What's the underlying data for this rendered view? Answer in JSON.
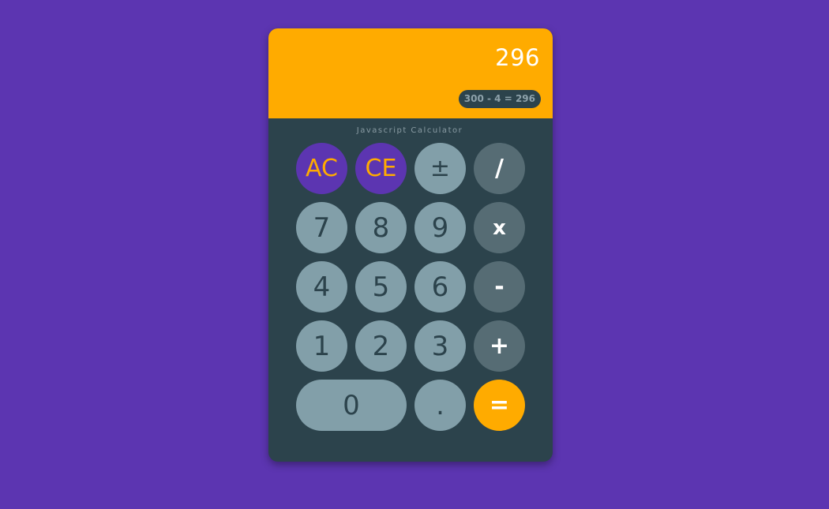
{
  "display": {
    "value": "296",
    "history": "300 - 4 = 296"
  },
  "caption": "Javascript Calculator",
  "buttons": {
    "all_clear": "AC",
    "clear_entry": "CE",
    "sign": "±",
    "divide": "/",
    "seven": "7",
    "eight": "8",
    "nine": "9",
    "multiply": "x",
    "four": "4",
    "five": "5",
    "six": "6",
    "subtract": "-",
    "one": "1",
    "two": "2",
    "three": "3",
    "add": "+",
    "zero": "0",
    "decimal": ".",
    "equals": "="
  },
  "colors": {
    "background": "#5c35b1",
    "display": "#ffab00",
    "body": "#2c434c",
    "digit_button": "#829fa9",
    "operator_button": "#566c74"
  }
}
